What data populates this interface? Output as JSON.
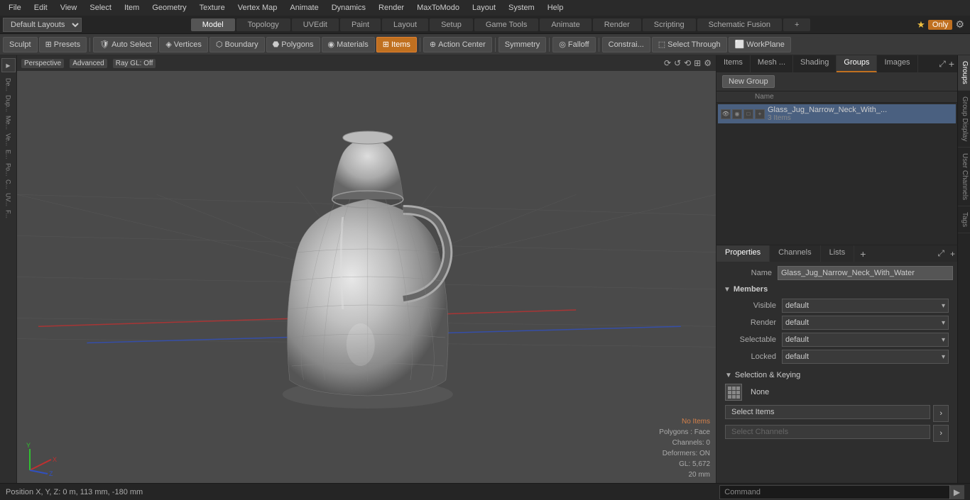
{
  "menuBar": {
    "items": [
      "File",
      "Edit",
      "View",
      "Select",
      "Item",
      "Geometry",
      "Texture",
      "Vertex Map",
      "Animate",
      "Dynamics",
      "Render",
      "MaxToModo",
      "Layout",
      "System",
      "Help"
    ]
  },
  "layoutBar": {
    "layoutSelect": "Default Layouts",
    "tabs": [
      "Model",
      "Topology",
      "UVEdit",
      "Paint",
      "Layout",
      "Setup",
      "Game Tools",
      "Animate",
      "Render",
      "Scripting",
      "Schematic Fusion"
    ],
    "activeTab": "Model",
    "addBtn": "+",
    "starBtn": "★",
    "onlyLabel": "Only",
    "gearBtn": "⚙"
  },
  "toolBar": {
    "sculpt": "Sculpt",
    "presets": "Presets",
    "autoSelect": "Auto Select",
    "vertices": "Vertices",
    "boundary": "Boundary",
    "polygons": "Polygons",
    "materials": "Materials",
    "items": "Items",
    "actionCenter": "Action Center",
    "symmetry": "Symmetry",
    "falloff": "Falloff",
    "constrain": "Constrai...",
    "selectThrough": "Select Through",
    "workPlane": "WorkPlane"
  },
  "viewport": {
    "perspLabel": "Perspective",
    "advLabel": "Advanced",
    "rayGlLabel": "Ray GL: Off",
    "status": {
      "noItems": "No Items",
      "polygons": "Polygons : Face",
      "channels": "Channels: 0",
      "deformers": "Deformers: ON",
      "gl": "GL: 5,672",
      "size": "20 mm"
    }
  },
  "rightPanel": {
    "tabs": [
      "Items",
      "Mesh ...",
      "Shading",
      "Groups",
      "Images"
    ],
    "activeTab": "Groups",
    "expandBtn1": "⤢",
    "expandBtn2": "+",
    "newGroupBtn": "New Group",
    "columnHeaders": {
      "name": "Name"
    },
    "groups": [
      {
        "name": "Glass_Jug_Narrow_Neck_With_...",
        "count": "3 Items",
        "selected": true
      }
    ],
    "propertiesTabs": [
      "Properties",
      "Channels",
      "Lists"
    ],
    "activePropertiesTab": "Properties",
    "nameValue": "Glass_Jug_Narrow_Neck_With_Water",
    "membersSection": "Members",
    "visible": "default",
    "render": "default",
    "selectable": "default",
    "locked": "default",
    "selectionKeying": "Selection & Keying",
    "noneLabel": "None",
    "selectItemsBtn": "Select Items",
    "selectChannelsBtn": "Select Channels",
    "arrowBtn": "›"
  },
  "verticalTabs": [
    "Groups",
    "Group Display",
    "User Channels",
    "Tags"
  ],
  "bottomBar": {
    "positionLabel": "Position X, Y, Z:",
    "positionValue": "0 m, 113 mm, -180 mm",
    "commandLabel": "Command"
  },
  "leftSidebar": {
    "tools": [
      "De...",
      "Dup...",
      "Me...",
      "Ve...",
      "E...",
      "Po...",
      "C...",
      "UV...",
      "F..."
    ]
  }
}
